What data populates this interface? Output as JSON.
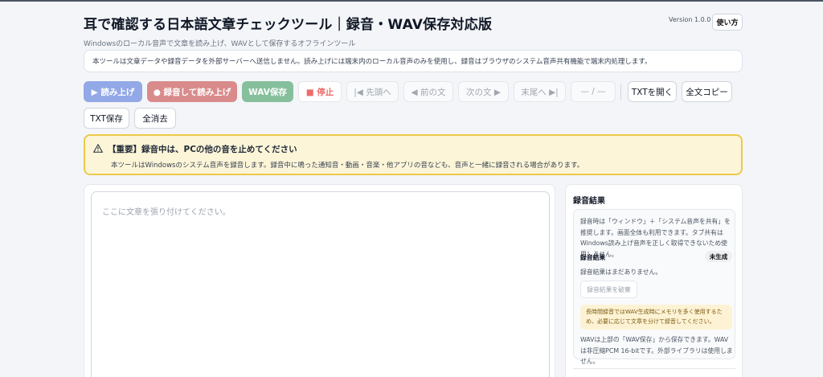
{
  "header": {
    "title": "耳で確認する日本語文章チェックツール｜録音・WAV保存対応版",
    "subtitle": "Windowsのローカル音声で文章を読み上げ、WAVとして保存するオフラインツール",
    "version": "Version 1.0.0",
    "help_label": "使い方"
  },
  "notice": "本ツールは文章データや録音データを外部サーバーへ送信しません。読み上げには端末内のローカル音声のみを使用し、録音はブラウザのシステム音声共有機能で端末内処理します。",
  "toolbar": {
    "read": "▶ 読み上げ",
    "record_read": "● 録音して読み上げ",
    "wav_save": "WAV保存",
    "stop": "■ 停止",
    "first": "|◀ 先頭へ",
    "prev": "◀ 前の文",
    "next": "次の文 ▶",
    "last": "末尾へ ▶|",
    "position": "— / —",
    "open_txt": "TXTを開く",
    "copy_all": "全文コピー",
    "save_txt": "TXT保存",
    "clear_all": "全消去"
  },
  "warning": {
    "title": "【重要】録音中は、PCの他の音を止めてください",
    "body": "本ツールはWindowsのシステム音声を録音します。録音中に鳴った通知音・動画・音楽・他アプリの音なども、音声と一緒に録音される場合があります。"
  },
  "editor": {
    "placeholder": "ここに文章を張り付けてください。"
  },
  "recording": {
    "title": "録音結果",
    "description": "録音時は「ウィンドウ」＋「システム音声を共有」を推奨します。画面全体も利用できます。タブ共有はWindows読み上げ音声を正しく取得できないため使用しません。",
    "result_label": "録音結果",
    "status_badge": "未生成",
    "empty_text": "録音結果はまだありません。",
    "discard_label": "録音結果を破棄",
    "memory_warning": "長時間録音ではWAV生成時にメモリを多く使用するため、必要に応じて文章を分けて録音してください。",
    "wav_note": "WAVは上部の「WAV保存」から保存できます。WAVは非圧縮PCM 16-bitです。外部ライブラリは使用しません。"
  }
}
